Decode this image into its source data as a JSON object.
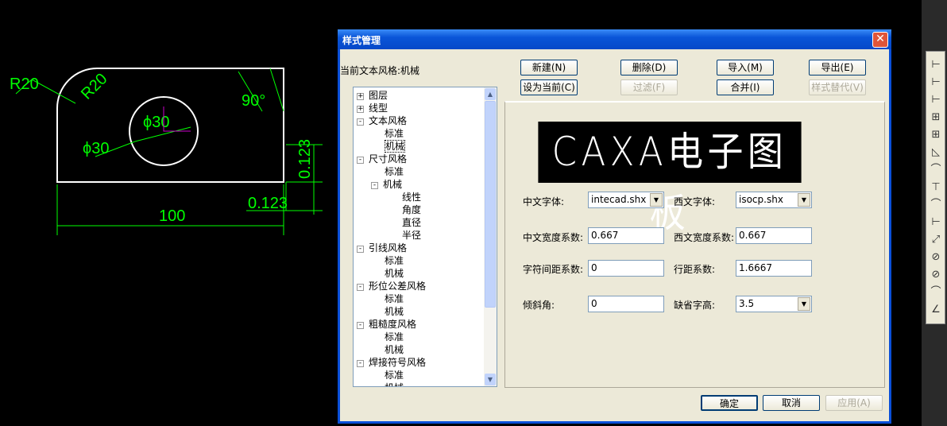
{
  "drawing": {
    "r_outer": "R20",
    "r_inner": "R20",
    "angle": "90°",
    "dia1": "ϕ30",
    "dia2": "ϕ30",
    "width": "100",
    "tol_v": "0.123",
    "tol_h": "0.123"
  },
  "dialog": {
    "title": "样式管理",
    "close": "✕",
    "current_style": "当前文本风格:机械",
    "buttons": {
      "new": "新建(N)",
      "delete": "删除(D)",
      "import": "导入(M)",
      "export": "导出(E)",
      "set_current": "设为当前(C)",
      "filter": "过滤(F)",
      "merge": "合并(I)",
      "replace": "样式替代(V)"
    },
    "tree": [
      {
        "label": "图层",
        "level": 0,
        "exp": "+"
      },
      {
        "label": "线型",
        "level": 0,
        "exp": "+"
      },
      {
        "label": "文本风格",
        "level": 0,
        "exp": "−"
      },
      {
        "label": "标准",
        "level": 1
      },
      {
        "label": "机械",
        "level": 1,
        "selected": true
      },
      {
        "label": "尺寸风格",
        "level": 0,
        "exp": "−"
      },
      {
        "label": "标准",
        "level": 1
      },
      {
        "label": "机械",
        "level": 1,
        "exp": "−"
      },
      {
        "label": "线性",
        "level": 2
      },
      {
        "label": "角度",
        "level": 2
      },
      {
        "label": "直径",
        "level": 2
      },
      {
        "label": "半径",
        "level": 2
      },
      {
        "label": "引线风格",
        "level": 0,
        "exp": "−"
      },
      {
        "label": "标准",
        "level": 1
      },
      {
        "label": "机械",
        "level": 1
      },
      {
        "label": "形位公差风格",
        "level": 0,
        "exp": "−"
      },
      {
        "label": "标准",
        "level": 1
      },
      {
        "label": "机械",
        "level": 1
      },
      {
        "label": "粗糙度风格",
        "level": 0,
        "exp": "−"
      },
      {
        "label": "标准",
        "level": 1
      },
      {
        "label": "机械",
        "level": 1
      },
      {
        "label": "焊接符号风格",
        "level": 0,
        "exp": "−"
      },
      {
        "label": "标准",
        "level": 1
      },
      {
        "label": "机械",
        "level": 1
      }
    ],
    "preview": "CAXA电子图板",
    "fields": {
      "cn_font_label": "中文字体:",
      "cn_font": "intecad.shx",
      "en_font_label": "西文字体:",
      "en_font": "isocp.shx",
      "cn_width_label": "中文宽度系数:",
      "cn_width": "0.667",
      "en_width_label": "西文宽度系数:",
      "en_width": "0.667",
      "char_space_label": "字符间距系数:",
      "char_space": "0",
      "line_space_label": "行距系数:",
      "line_space": "1.6667",
      "slant_label": "倾斜角:",
      "slant": "0",
      "height_label": "缺省字高:",
      "height": "3.5"
    },
    "ok": "确定",
    "cancel": "取消",
    "apply": "应用(A)"
  },
  "toolbar": [
    "linear-dim",
    "smart-dim",
    "baseline-dim",
    "continuous-dim",
    "chain-dim",
    "angle-dim",
    "arc-angle-dim",
    "leader",
    "arc-dim",
    "three-point-dim",
    "aligned-dim",
    "diameter-dim",
    "radius-dim",
    "arc-length-dim",
    "angle-dim-2"
  ]
}
